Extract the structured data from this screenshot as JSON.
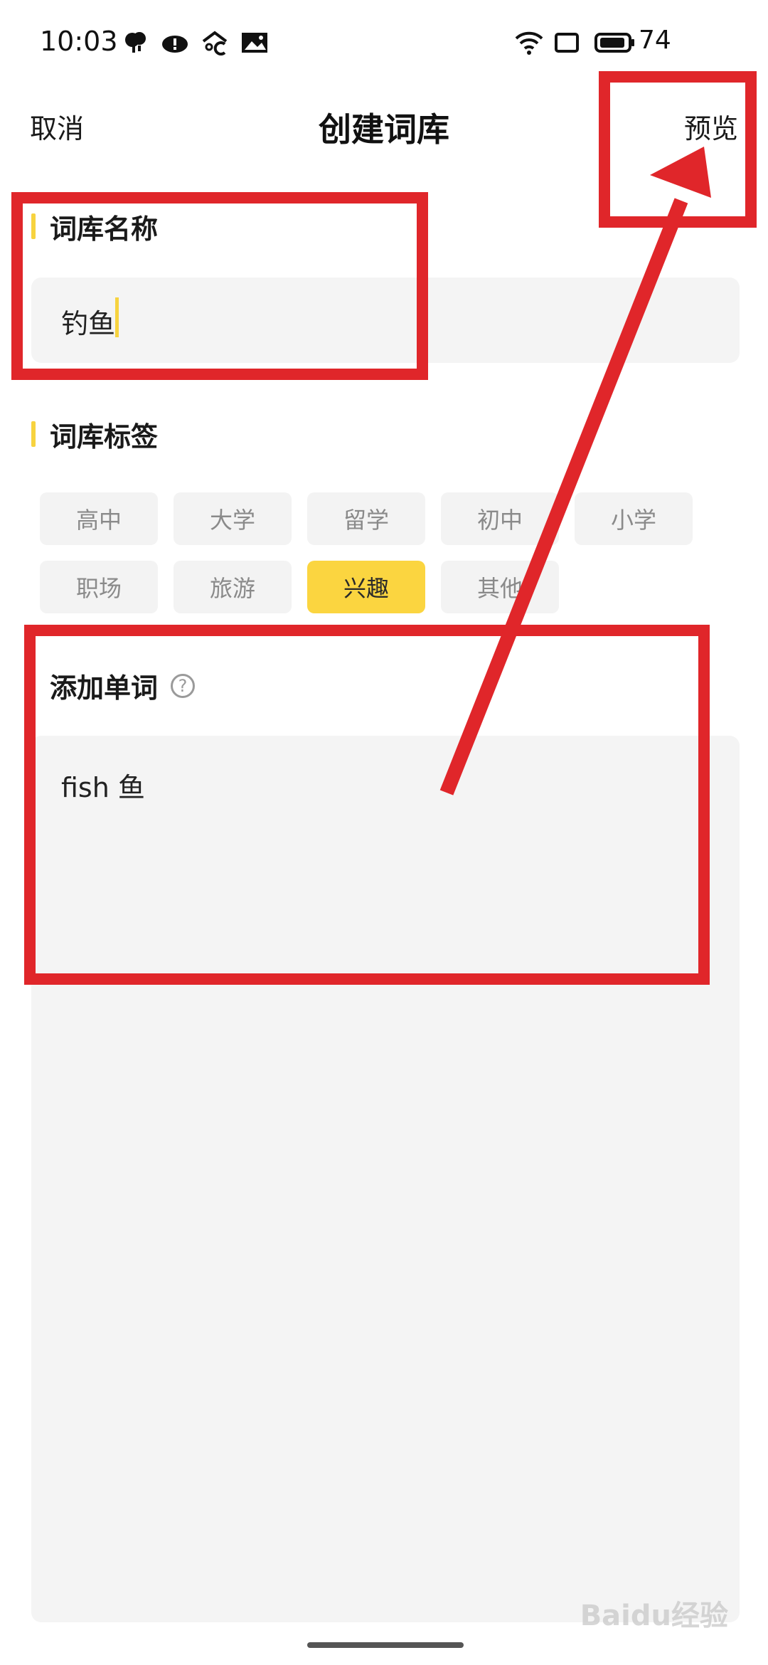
{
  "status_bar": {
    "time": "10:03",
    "battery": "74",
    "icons": [
      "weather-icon",
      "cloud-alert-icon",
      "temperature-icon",
      "image-icon",
      "wifi-icon",
      "screen-icon",
      "battery-icon"
    ]
  },
  "nav": {
    "cancel_label": "取消",
    "title": "创建词库",
    "preview_label": "预览"
  },
  "name_section": {
    "heading": "词库名称",
    "value": "钓鱼"
  },
  "tag_section": {
    "heading": "词库标签",
    "tags": [
      {
        "label": "高中",
        "selected": false
      },
      {
        "label": "大学",
        "selected": false
      },
      {
        "label": "留学",
        "selected": false
      },
      {
        "label": "初中",
        "selected": false
      },
      {
        "label": "小学",
        "selected": false
      },
      {
        "label": "职场",
        "selected": false
      },
      {
        "label": "旅游",
        "selected": false
      },
      {
        "label": "兴趣",
        "selected": true
      },
      {
        "label": "其他",
        "selected": false
      }
    ]
  },
  "words_section": {
    "heading": "添加单词",
    "help_glyph": "?",
    "content": "fish 鱼"
  },
  "watermark": "Baidu经验",
  "colors": {
    "accent": "#fbd540",
    "annotation": "#e0262a",
    "input_bg": "#f4f4f4"
  }
}
